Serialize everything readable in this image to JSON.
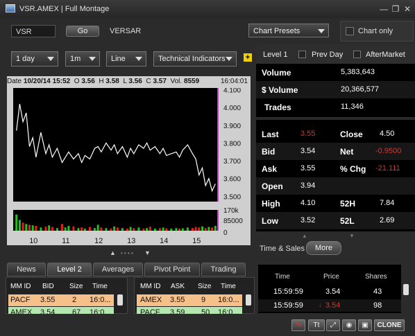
{
  "window": {
    "title": "VSR.AMEX | Full Montage",
    "min": "—",
    "restore": "❐",
    "close": "✕"
  },
  "symbol_bar": {
    "symbol_value": "VSR",
    "go_label": "Go",
    "company_name": "VERSAR"
  },
  "chart_presets": {
    "label": "Chart Presets",
    "chart_only_label": "Chart only"
  },
  "controls": {
    "period": "1 day",
    "interval": "1m",
    "style": "Line",
    "indicators": "Technical Indicators",
    "add_icon": "+"
  },
  "chart_header": {
    "date_label": "Date",
    "date_value": "10/20/14",
    "time_value": "15:52",
    "o_label": "O",
    "o_value": "3.56",
    "h_label": "H",
    "h_value": "3.58",
    "l_label": "L",
    "l_value": "3.56",
    "c_label": "C",
    "c_value": "3.57",
    "vol_label": "Vol.",
    "vol_value": "8559",
    "clock": "16:04:01"
  },
  "chart_data": {
    "type": "line",
    "x_ticks": [
      "10",
      "11",
      "12",
      "13",
      "14",
      "15"
    ],
    "y_ticks": [
      "4.100",
      "4.000",
      "3.900",
      "3.800",
      "3.700",
      "3.600",
      "3.500"
    ],
    "ylim": [
      3.47,
      4.11
    ],
    "vol_ticks": [
      "170k",
      "85000",
      "0"
    ],
    "vol_ylim": [
      0,
      170000
    ],
    "x": [
      9.5,
      9.6,
      9.7,
      9.8,
      9.9,
      10.0,
      10.1,
      10.25,
      10.4,
      10.5,
      10.6,
      10.75,
      10.9,
      11.0,
      11.1,
      11.25,
      11.4,
      11.5,
      11.6,
      11.75,
      11.9,
      12.0,
      12.1,
      12.25,
      12.4,
      12.5,
      12.6,
      12.75,
      12.9,
      13.0,
      13.1,
      13.25,
      13.4,
      13.5,
      13.6,
      13.75,
      13.9,
      14.0,
      14.1,
      14.25,
      14.4,
      14.5,
      14.6,
      14.75,
      14.9,
      15.0,
      15.1,
      15.2,
      15.3,
      15.4,
      15.5,
      15.6
    ],
    "y": [
      3.87,
      4.02,
      3.92,
      3.97,
      3.78,
      3.83,
      3.72,
      3.86,
      3.74,
      3.79,
      3.72,
      3.77,
      3.69,
      3.72,
      3.75,
      3.71,
      3.74,
      3.69,
      3.73,
      3.71,
      3.77,
      3.78,
      3.75,
      3.8,
      3.76,
      3.79,
      3.74,
      3.78,
      3.72,
      3.77,
      3.74,
      3.79,
      3.77,
      3.8,
      3.76,
      3.78,
      3.74,
      3.77,
      3.73,
      3.74,
      3.75,
      3.72,
      3.76,
      3.79,
      3.74,
      3.71,
      3.62,
      3.66,
      3.56,
      3.6,
      3.53,
      3.57
    ],
    "volume": [
      60,
      40,
      30,
      25,
      22,
      20,
      18,
      12,
      15,
      20,
      14,
      10,
      25,
      12,
      18,
      16,
      10,
      12,
      8,
      14,
      10,
      22,
      12,
      10,
      8,
      16,
      12,
      10,
      8,
      14,
      10,
      12,
      8,
      10,
      15,
      8,
      10,
      12,
      9,
      8,
      10,
      8,
      9,
      12,
      10,
      14,
      12,
      16,
      10,
      14,
      12,
      18
    ],
    "volume_scale_k": 170,
    "line_color": "#ffffff",
    "volume_colors": [
      "#e02020",
      "#20c020"
    ],
    "cursor_color": "#c040c0",
    "grid": false
  },
  "chart_nav": {
    "up": "▲",
    "dots": "• • • •",
    "down": "▼"
  },
  "level1": {
    "title": "Level 1",
    "prev_day": "Prev Day",
    "after_market": "AfterMarket",
    "volume_label": "Volume",
    "volume_value": "5,383,643",
    "dollar_volume_label": "$ Volume",
    "dollar_volume_value": "20,366,577",
    "trades_label": "Trades",
    "trades_value": "11,346",
    "last_label": "Last",
    "last_value": "3.55",
    "close_label": "Close",
    "close_value": "4.50",
    "bid_label": "Bid",
    "bid_value": "3.54",
    "net_label": "Net",
    "net_value": "-0.9500",
    "ask_label": "Ask",
    "ask_value": "3.55",
    "pct_label": "% Chg",
    "pct_value": "-21.111",
    "open_label": "Open",
    "open_value": "3.94",
    "high_label": "High",
    "high_value": "4.10",
    "h52_label": "52H",
    "h52_value": "7.84",
    "low_label": "Low",
    "low_value": "3.52",
    "l52_label": "52L",
    "l52_value": "2.69"
  },
  "tabs": [
    "News",
    "Level 2",
    "Averages",
    "Pivot Point",
    "Trading"
  ],
  "level2": {
    "bid_headers": [
      "MM ID",
      "BID",
      "Size",
      "Time"
    ],
    "ask_headers": [
      "MM ID",
      "ASK",
      "Size",
      "Time"
    ],
    "bid_rows": [
      [
        "PACF",
        "3.55",
        "2",
        "16:0..."
      ],
      [
        "AMEX",
        "3.54",
        "67",
        "16:0..."
      ]
    ],
    "ask_rows": [
      [
        "AMEX",
        "3.55",
        "9",
        "16:0..."
      ],
      [
        "PACF",
        "3.59",
        "50",
        "16:0..."
      ]
    ],
    "row_colors": [
      "#f5c08a",
      "#b6e6b0"
    ]
  },
  "time_sales": {
    "title": "Time & Sales",
    "more": "More",
    "headers": [
      "Time",
      "Price",
      "Shares"
    ],
    "rows": [
      [
        "15:59:59",
        "3.54",
        "43"
      ],
      [
        "15:59:59",
        "3.54",
        "98"
      ]
    ]
  },
  "toolbar": {
    "icons": [
      "no-edit-icon",
      "text-size-icon",
      "expand-icon",
      "globe-icon",
      "camera-icon"
    ],
    "clone": "CLONE"
  }
}
